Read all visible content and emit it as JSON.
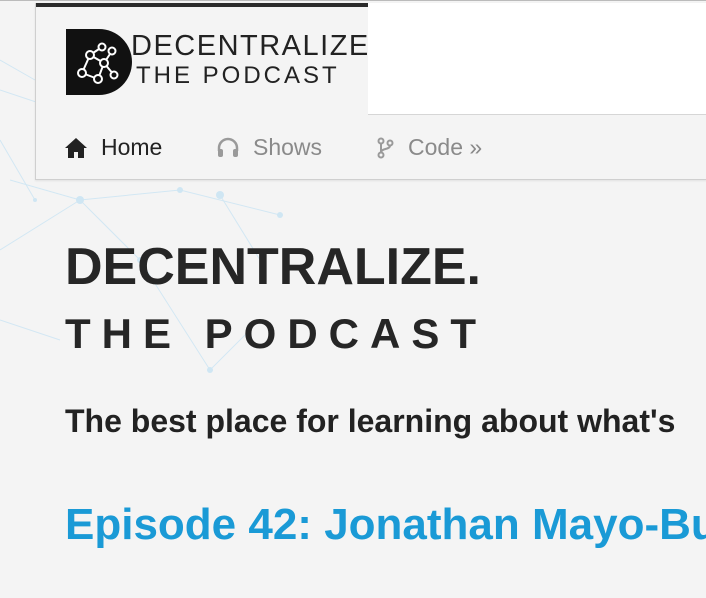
{
  "brand": {
    "logo_line1": "DECENTRALIZE",
    "logo_line2": "THE PODCAST"
  },
  "nav": {
    "items": [
      {
        "label": "Home",
        "icon": "home-icon",
        "active": true
      },
      {
        "label": "Shows",
        "icon": "headphones-icon",
        "active": false
      },
      {
        "label": "Code »",
        "icon": "code-branch-icon",
        "active": false
      }
    ]
  },
  "hero": {
    "title": "DECENTRALIZE.",
    "subtitle": "THE PODCAST",
    "tagline": "The best place for learning about what's"
  },
  "episode": {
    "title": "Episode 42: Jonathan Mayo-Bu"
  },
  "colors": {
    "link": "#1a9ad6",
    "text": "#262626",
    "muted_nav": "#8a8a8a",
    "background": "#f4f4f4"
  }
}
